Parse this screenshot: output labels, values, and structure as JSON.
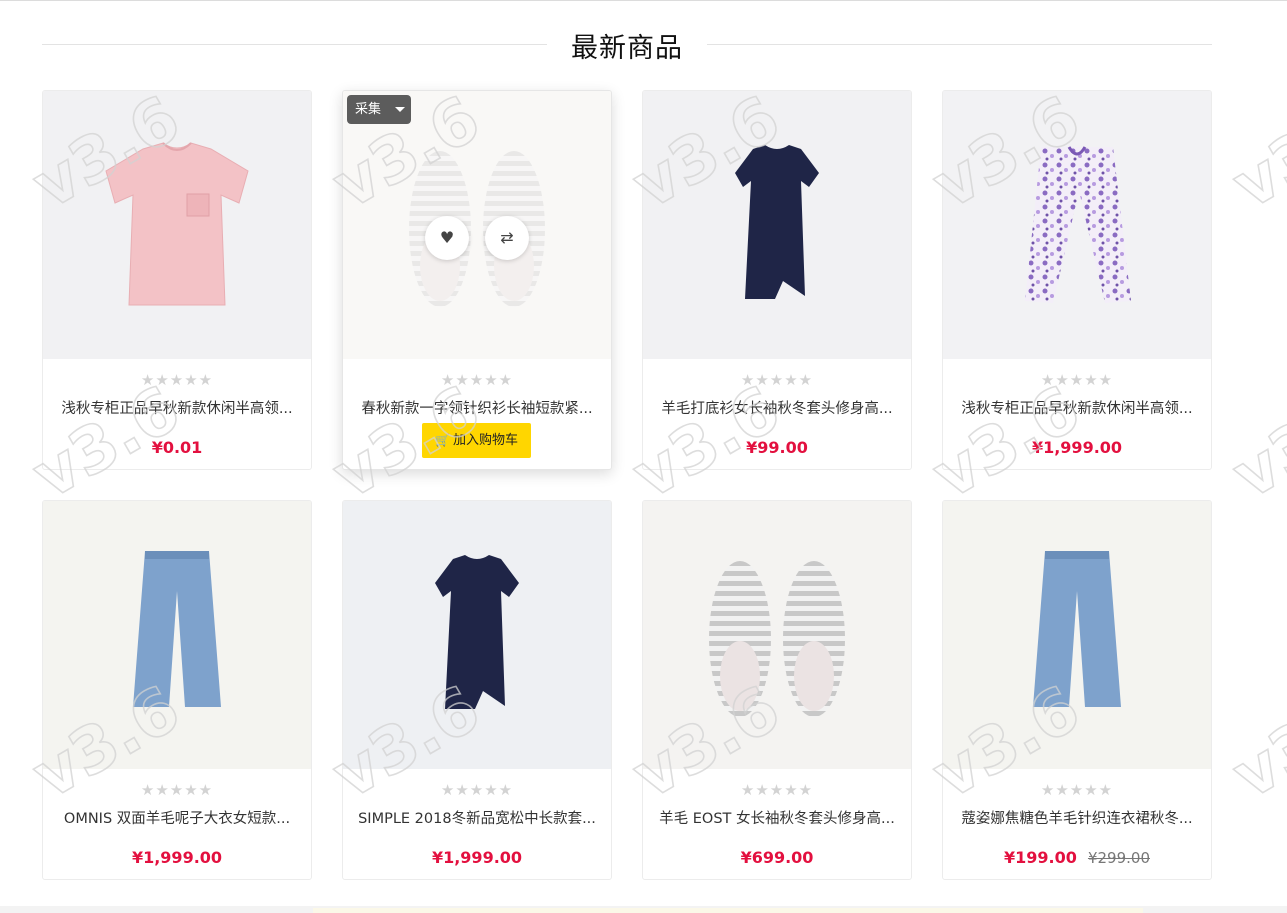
{
  "section": {
    "title": "最新商品"
  },
  "watermark_text": "v3.6",
  "rating_glyphs": "★★★★★",
  "collect": {
    "label": "采集"
  },
  "add_to_cart": {
    "label": "加入购物车"
  },
  "products": [
    {
      "title": "浅秋专柜正品早秋新款休闲半高领...",
      "price": "¥0.01",
      "old_price": "",
      "rating": 0,
      "image": "pink-tshirt"
    },
    {
      "title": "春秋新款一字领针织衫长袖短款紧...",
      "price": "",
      "old_price": "",
      "rating": 0,
      "image": "slippers"
    },
    {
      "title": "羊毛打底衫女长袖秋冬套头修身高...",
      "price": "¥99.00",
      "old_price": "",
      "rating": 0,
      "image": "navy-dress"
    },
    {
      "title": "浅秋专柜正品早秋新款休闲半高领...",
      "price": "¥1,999.00",
      "old_price": "",
      "rating": 0,
      "image": "floral-pants"
    },
    {
      "title": "OMNIS 双面羊毛呢子大衣女短款...",
      "price": "¥1,999.00",
      "old_price": "",
      "rating": 0,
      "image": "jeans"
    },
    {
      "title": "SIMPLE 2018冬新品宽松中长款套...",
      "price": "¥1,999.00",
      "old_price": "",
      "rating": 0,
      "image": "navy-dress"
    },
    {
      "title": "羊毛 EOST 女长袖秋冬套头修身高...",
      "price": "¥699.00",
      "old_price": "",
      "rating": 0,
      "image": "slippers"
    },
    {
      "title": "蔻姿娜焦糖色羊毛针织连衣裙秋冬...",
      "price": "¥199.00",
      "old_price": "¥299.00",
      "rating": 0,
      "image": "jeans"
    }
  ],
  "colors": {
    "price": "#e3103f",
    "cart_button": "#ffd600",
    "star_empty": "#d3d3d3"
  },
  "icons": {
    "wishlist": "heart-icon",
    "compare": "compare-arrows-icon",
    "cart": "cart-icon",
    "collect_menu": "caret-down-icon"
  }
}
